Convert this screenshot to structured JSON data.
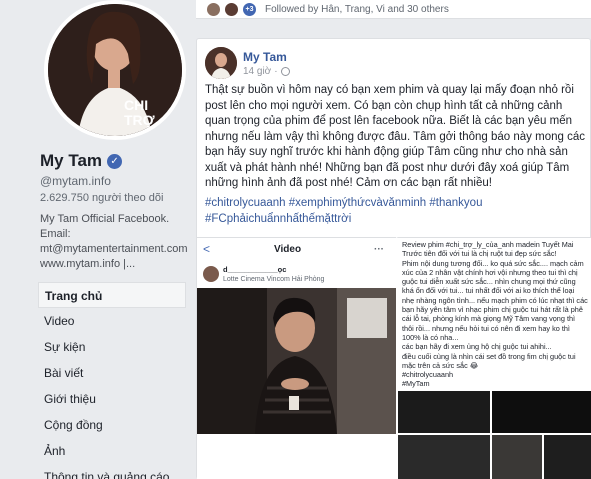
{
  "page": {
    "name": "My Tam",
    "handle": "@mytam.info",
    "followers": "2.629.750 người theo dõi",
    "about": [
      "My Tam Official Facebook.",
      "Email:",
      "mt@mytamentertainment.com",
      "www.mytam.info |..."
    ],
    "cover_text": "CHI TRO L CUA ANH"
  },
  "nav": {
    "items": [
      "Trang chủ",
      "Video",
      "Sự kiện",
      "Bài viết",
      "Giới thiệu",
      "Cộng đồng",
      "Ảnh",
      "Thông tin và quảng cáo"
    ],
    "active_index": 0
  },
  "followed_by": {
    "count_badge": "+3",
    "text": "Followed by Hân, Trang, Vi and 30 others"
  },
  "post": {
    "author": "My Tam",
    "time": "14 giờ",
    "text": "Thật sự buồn vì hôm nay có bạn xem phim và quay lại mấy đoạn nhỏ rồi post lên cho mọi người xem. Có bạn còn chụp hình tất cả những cảnh quan trọng của phim để post lên facebook nữa. Biết là các bạn yêu mến nhưng nếu làm vậy thì không được đâu. Tâm gởi thông báo này mong các bạn hãy suy nghĩ trước khi hành động giúp Tâm cũng như cho nhà sản xuất và phát hành nhé! Những bạn đã post như dưới đây xoá giúp Tâm những hình ảnh đã post nhé! Cảm ơn các bạn rất nhiều!",
    "hashtags": "#chitrolycuaanh #xemphimýthứcvàvănminh #thankyou #FCphảichuẩnnhấthếmặttrời"
  },
  "media_left": {
    "bar_title": "Video",
    "back": "<",
    "dots": "···",
    "user": "d____________ọc",
    "location": "Lotte Cinema Vincom Hải Phòng"
  },
  "media_right": {
    "review": "Review phim #chi_trợ_ly_của_anh madein Tuyết Mai\nTrước tiên đối với tui là chị ruột tui đẹp sức sắc!\nPhim nội dung tương đối... ko quá sức sắc.... mạch cảm xúc của 2 nhân vật chính hơi vội nhưng theo tui thì chị guộc tui diễn xuất sức sắc... nhìn chung mọi thứ cũng khá ổn đối với tui... tui nhất đối với ai ko thích thể loại nhẹ nhàng ngôn tình... nếu mạch phim có lúc nhạt thì các bạn hãy yên tâm vì nhạc phim chị guộc tui hát rất là phê cái lỗ tai, phòng kính mà giọng Mỹ Tâm vang vọng thì thôi rồi... nhưng nếu hỏi tui có nên đi xem hay ko thì 100% là có nha...\n các bạn hãy đi xem ủng hộ chị guộc tui ahihi...\nđiều cuối cùng là nhìn cái set đồ trong fim chị guộc tui mặc trên cả sức sắc 😂\n#chitrolycuaanh\n#MyTam"
  },
  "colors": {
    "link": "#365899",
    "brand": "#4267b2",
    "bg": "#e9ebee"
  }
}
